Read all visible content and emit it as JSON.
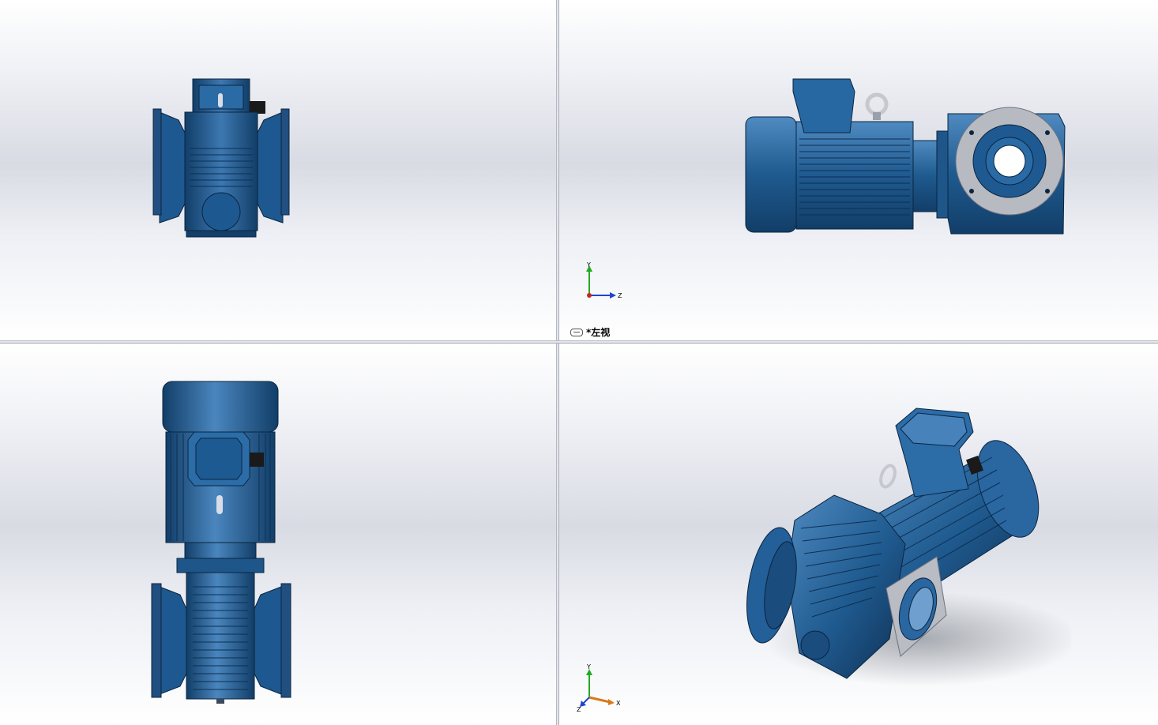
{
  "viewports": {
    "top_left": {
      "name": ""
    },
    "top_right": {
      "name": "*左视"
    },
    "bottom_left": {
      "name": ""
    },
    "bottom_right": {
      "name": ""
    }
  },
  "triad": {
    "x": "X",
    "y": "Y",
    "z": "Z"
  },
  "colors": {
    "model_blue": "#1f5a8f",
    "model_dark": "#0f2f52",
    "model_light": "#4f8ac0",
    "flange_gray": "#b9bcc2",
    "axis_x": "#cc2222",
    "axis_y": "#22aa22",
    "axis_z": "#2244cc",
    "axis_x_iso": "#d87a1a"
  }
}
